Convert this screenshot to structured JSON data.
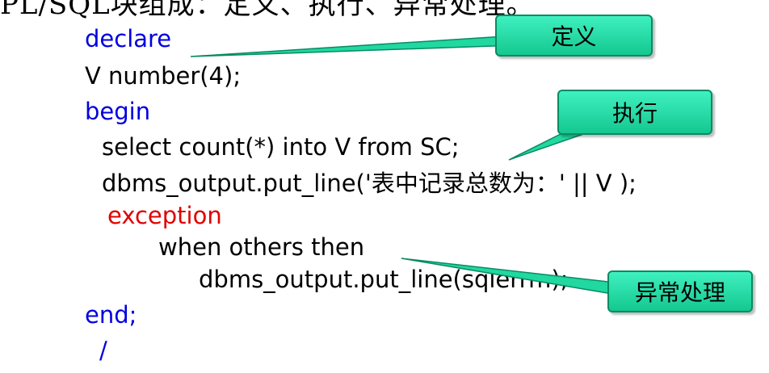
{
  "heading": "PL/SQL块组成：定义、执行、异常处理。",
  "code": {
    "line1": "declare",
    "line2": "V  number(4);",
    "line3": "begin",
    "line4": "select count(*)   into V   from SC;",
    "line5_prefix": "dbms_output.put_line('",
    "line5_zh": "表中记录总数为：",
    "line5_suffix": "' || V );",
    "line6": "exception",
    "line7": "when others then",
    "line8": "dbms_output.put_line(sqlerrm);",
    "line9": "end;",
    "line10": "/"
  },
  "callouts": {
    "define": "定义",
    "execute": "执行",
    "exception": "异常处理"
  },
  "colors": {
    "keyword": "#0000e0",
    "exception_keyword": "#e00000",
    "callout_fill": "#20d8a0"
  }
}
